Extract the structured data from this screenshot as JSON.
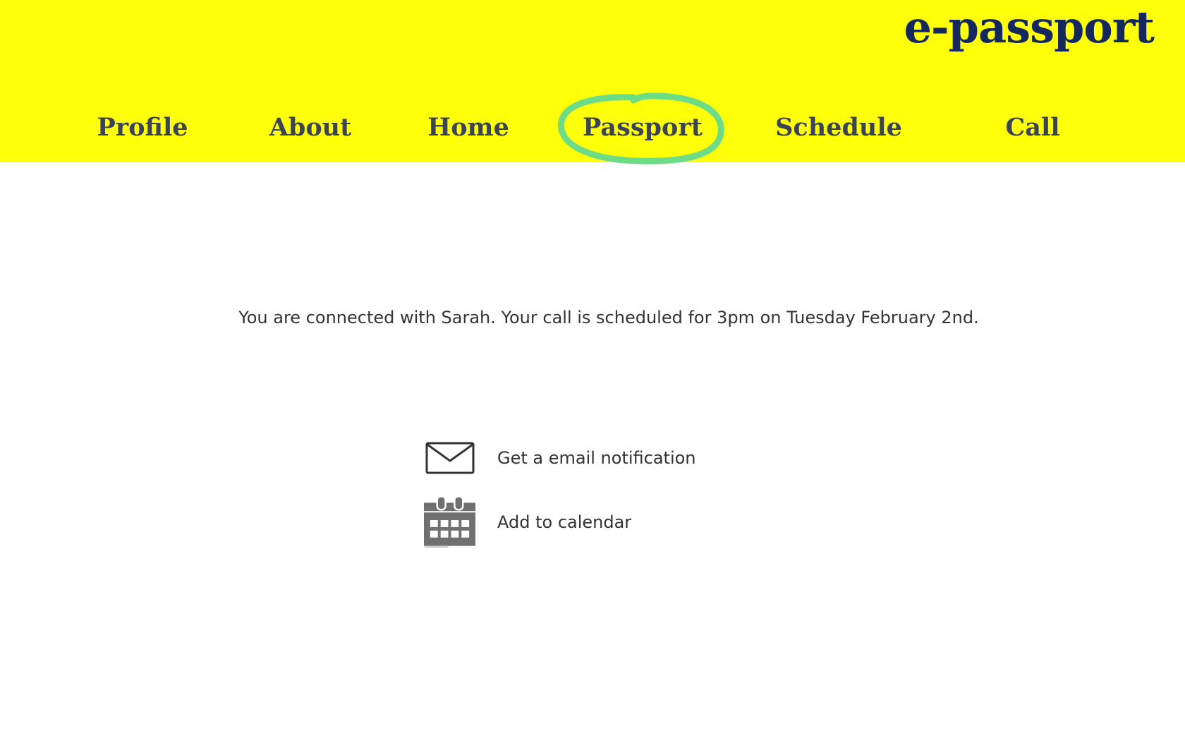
{
  "header": {
    "logo": "e-passport",
    "background_color": "#ffff0a",
    "logo_color": "#14285e",
    "nav_color": "#3b4452",
    "highlight_color": "#6ddc86"
  },
  "nav": {
    "items": [
      {
        "label": "Profile"
      },
      {
        "label": "About"
      },
      {
        "label": "Home"
      },
      {
        "label": "Passport",
        "highlighted": true
      },
      {
        "label": "Schedule"
      },
      {
        "label": "Call"
      }
    ]
  },
  "main": {
    "message": "You are connected with Sarah. Your call is scheduled for 3pm on Tuesday February 2nd.",
    "actions": [
      {
        "icon": "envelope-icon",
        "label": "Get a email notification"
      },
      {
        "icon": "calendar-icon",
        "label": "Add to calendar"
      }
    ]
  }
}
